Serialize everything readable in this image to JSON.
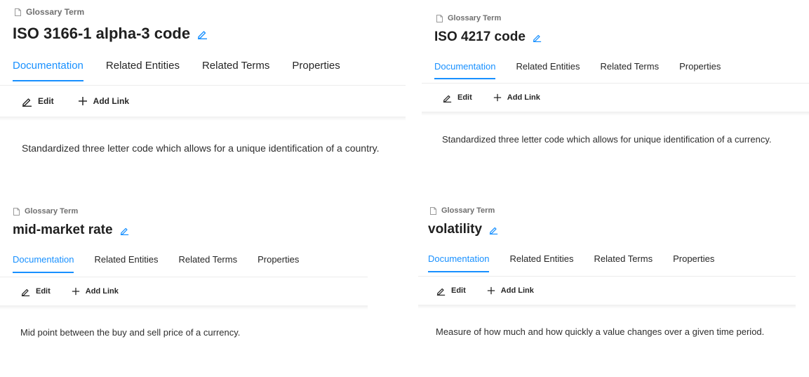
{
  "colors": {
    "accent": "#1890ff",
    "text": "#262626",
    "muted": "#6f6f6f",
    "divider": "#ececec"
  },
  "icons": {
    "type": "document-icon",
    "title_edit": "pencil-icon",
    "edit": "pencil-icon",
    "add": "plus-icon"
  },
  "panels": [
    {
      "entity_type": "Glossary Term",
      "title": "ISO 3166-1 alpha-3 code",
      "tabs": [
        "Documentation",
        "Related Entities",
        "Related Terms",
        "Properties"
      ],
      "active_tab": "Documentation",
      "toolbar": {
        "edit_label": "Edit",
        "add_link_label": "Add Link"
      },
      "description": "Standardized three letter code which allows for a unique identification of a country."
    },
    {
      "entity_type": "Glossary Term",
      "title": "ISO 4217 code",
      "tabs": [
        "Documentation",
        "Related Entities",
        "Related Terms",
        "Properties"
      ],
      "active_tab": "Documentation",
      "toolbar": {
        "edit_label": "Edit",
        "add_link_label": "Add Link"
      },
      "description": "Standardized three letter code which allows for unique identification of a currency."
    },
    {
      "entity_type": "Glossary Term",
      "title": "mid-market rate",
      "tabs": [
        "Documentation",
        "Related Entities",
        "Related Terms",
        "Properties"
      ],
      "active_tab": "Documentation",
      "toolbar": {
        "edit_label": "Edit",
        "add_link_label": "Add Link"
      },
      "description": "Mid point between the buy and sell price of a currency."
    },
    {
      "entity_type": "Glossary Term",
      "title": "volatility",
      "tabs": [
        "Documentation",
        "Related Entities",
        "Related Terms",
        "Properties"
      ],
      "active_tab": "Documentation",
      "toolbar": {
        "edit_label": "Edit",
        "add_link_label": "Add Link"
      },
      "description": "Measure of how much and how quickly a value changes over a given time period."
    }
  ]
}
